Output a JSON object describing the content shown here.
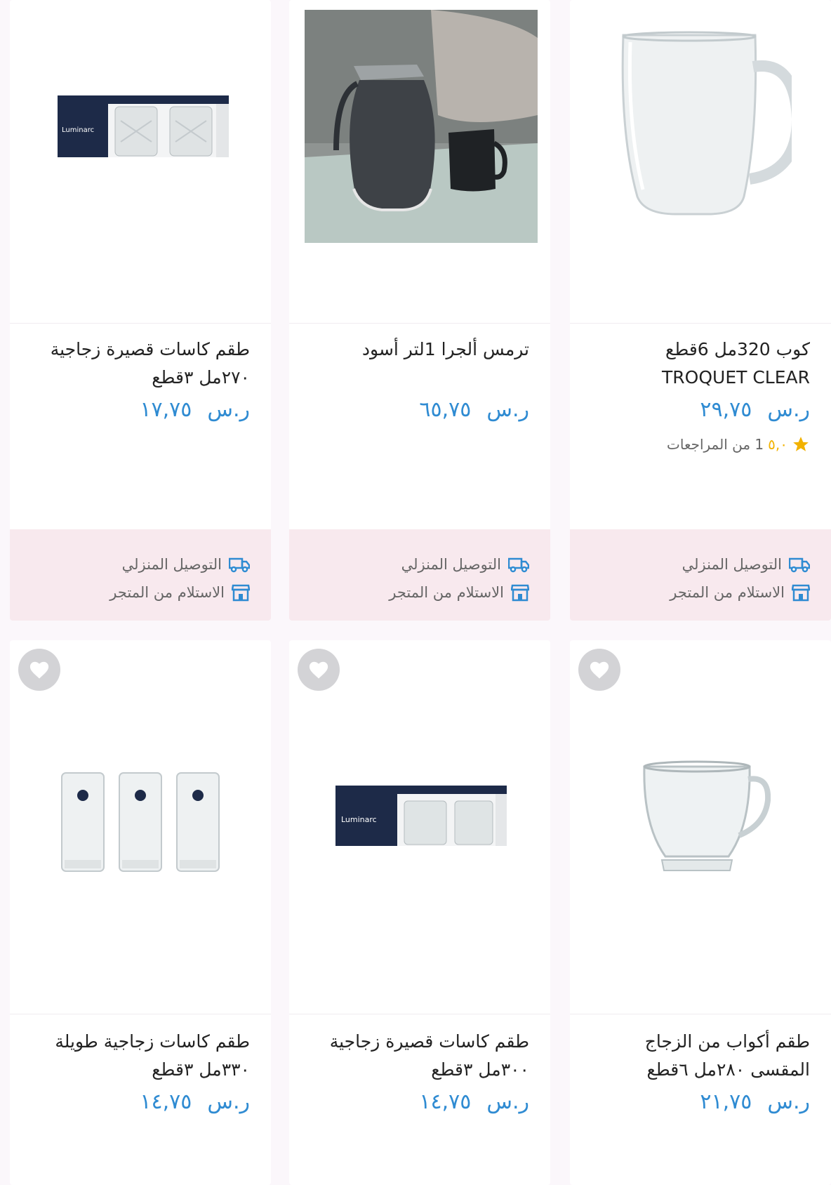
{
  "colors": {
    "price": "#2f8bd2",
    "delivery_bg": "#f8e9ee",
    "star": "#f2b200",
    "fav_bg": "#d3d3d6"
  },
  "products": [
    {
      "name": "كوب 320مل 6قطع TROQUET CLEAR",
      "currency": "ر.س",
      "price": "٢٩,٧٥",
      "rating_score": "٥,٠",
      "rating_text": "1 من المراجعات",
      "delivery": "التوصيل المنزلي",
      "pickup": "الاستلام من المتجر"
    },
    {
      "name": "ترمس ألجرا 1لتر أسود",
      "currency": "ر.س",
      "price": "٦٥,٧٥",
      "delivery": "التوصيل المنزلي",
      "pickup": "الاستلام من المتجر"
    },
    {
      "name": "طقم كاسات قصيرة زجاجية ٢٧٠مل ٣قطع",
      "currency": "ر.س",
      "price": "١٧,٧٥",
      "delivery": "التوصيل المنزلي",
      "pickup": "الاستلام من المتجر"
    },
    {
      "name": "طقم أكواب من الزجاج المقسى ٢٨٠مل ٦قطع",
      "currency": "ر.س",
      "price": "٢١,٧٥"
    },
    {
      "name": "طقم كاسات قصيرة زجاجية ٣٠٠مل ٣قطع",
      "currency": "ر.س",
      "price": "١٤,٧٥"
    },
    {
      "name": "طقم كاسات زجاجية طويلة ٣٣٠مل ٣قطع",
      "currency": "ر.س",
      "price": "١٤,٧٥"
    }
  ],
  "brand_label": "Luminarc"
}
